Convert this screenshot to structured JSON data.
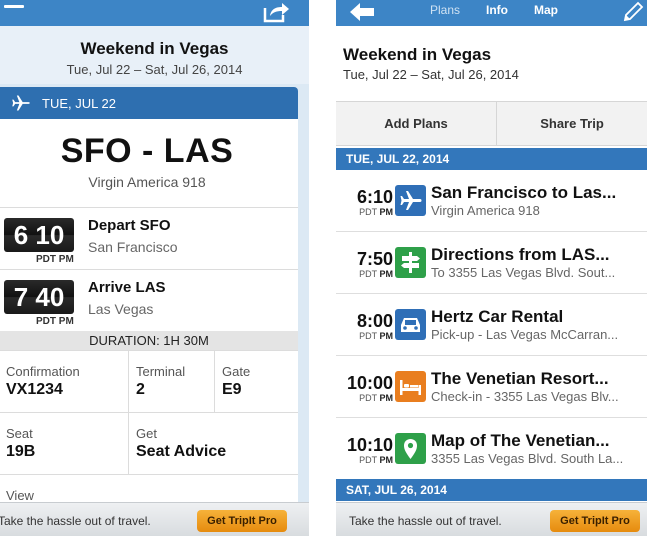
{
  "left": {
    "header": {
      "title": "Weekend in Vegas",
      "dates": "Tue, Jul 22 – Sat, Jul 26, 2014"
    },
    "day_label": "TUE, JUL 22",
    "route": "SFO - LAS",
    "flight": "Virgin America 918",
    "depart": {
      "time": "6 10",
      "tz": "PDT PM",
      "title": "Depart SFO",
      "city": "San Francisco"
    },
    "arrive": {
      "time": "7 40",
      "tz": "PDT PM",
      "title": "Arrive LAS",
      "city": "Las Vegas"
    },
    "duration": "DURATION: 1H 30M",
    "details": {
      "confirmation_label": "Confirmation",
      "confirmation_value": "VX1234",
      "terminal_label": "Terminal",
      "terminal_value": "2",
      "gate_label": "Gate",
      "gate_value": "E9",
      "seat_label": "Seat",
      "seat_value": "19B",
      "get_label": "Get",
      "get_value": "Seat Advice",
      "view_label": "View"
    },
    "ad": {
      "text": "Take the hassle out of travel.",
      "button": "Get TripIt Pro"
    }
  },
  "right": {
    "nav": {
      "plans": "Plans",
      "info": "Info",
      "map": "Map"
    },
    "header": {
      "title": "Weekend in Vegas",
      "dates": "Tue, Jul 22 – Sat, Jul 26, 2014"
    },
    "actions": {
      "add": "Add Plans",
      "share": "Share Trip"
    },
    "day1": "TUE, JUL 22, 2014",
    "day2": "SAT, JUL 26, 2014",
    "items": [
      {
        "time": "6:10",
        "tz": "PDT",
        "ampm": "PM",
        "icon": "airplane-icon",
        "name": "San Francisco to Las...",
        "sub": "Virgin America 918"
      },
      {
        "time": "7:50",
        "tz": "PDT",
        "ampm": "PM",
        "icon": "signpost-icon",
        "name": "Directions from LAS...",
        "sub": "To 3355 Las Vegas Blvd. Sout..."
      },
      {
        "time": "8:00",
        "tz": "PDT",
        "ampm": "PM",
        "icon": "car-icon",
        "name": "Hertz Car Rental",
        "sub": "Pick-up - Las Vegas McCarran..."
      },
      {
        "time": "10:00",
        "tz": "PDT",
        "ampm": "PM",
        "icon": "bed-icon",
        "name": "The Venetian Resort...",
        "sub": "Check-in - 3355 Las Vegas Blv..."
      },
      {
        "time": "10:10",
        "tz": "PDT",
        "ampm": "PM",
        "icon": "map-pin-icon",
        "name": "Map of The Venetian...",
        "sub": "3355 Las Vegas Blvd. South La..."
      }
    ],
    "ad": {
      "text": "Take the hassle out of travel.",
      "button": "Get TripIt Pro"
    }
  },
  "colors": {
    "nav_blue": "#3d85c6",
    "day_blue": "#3377bb",
    "green": "#2ea049",
    "orange": "#e97e1f"
  }
}
